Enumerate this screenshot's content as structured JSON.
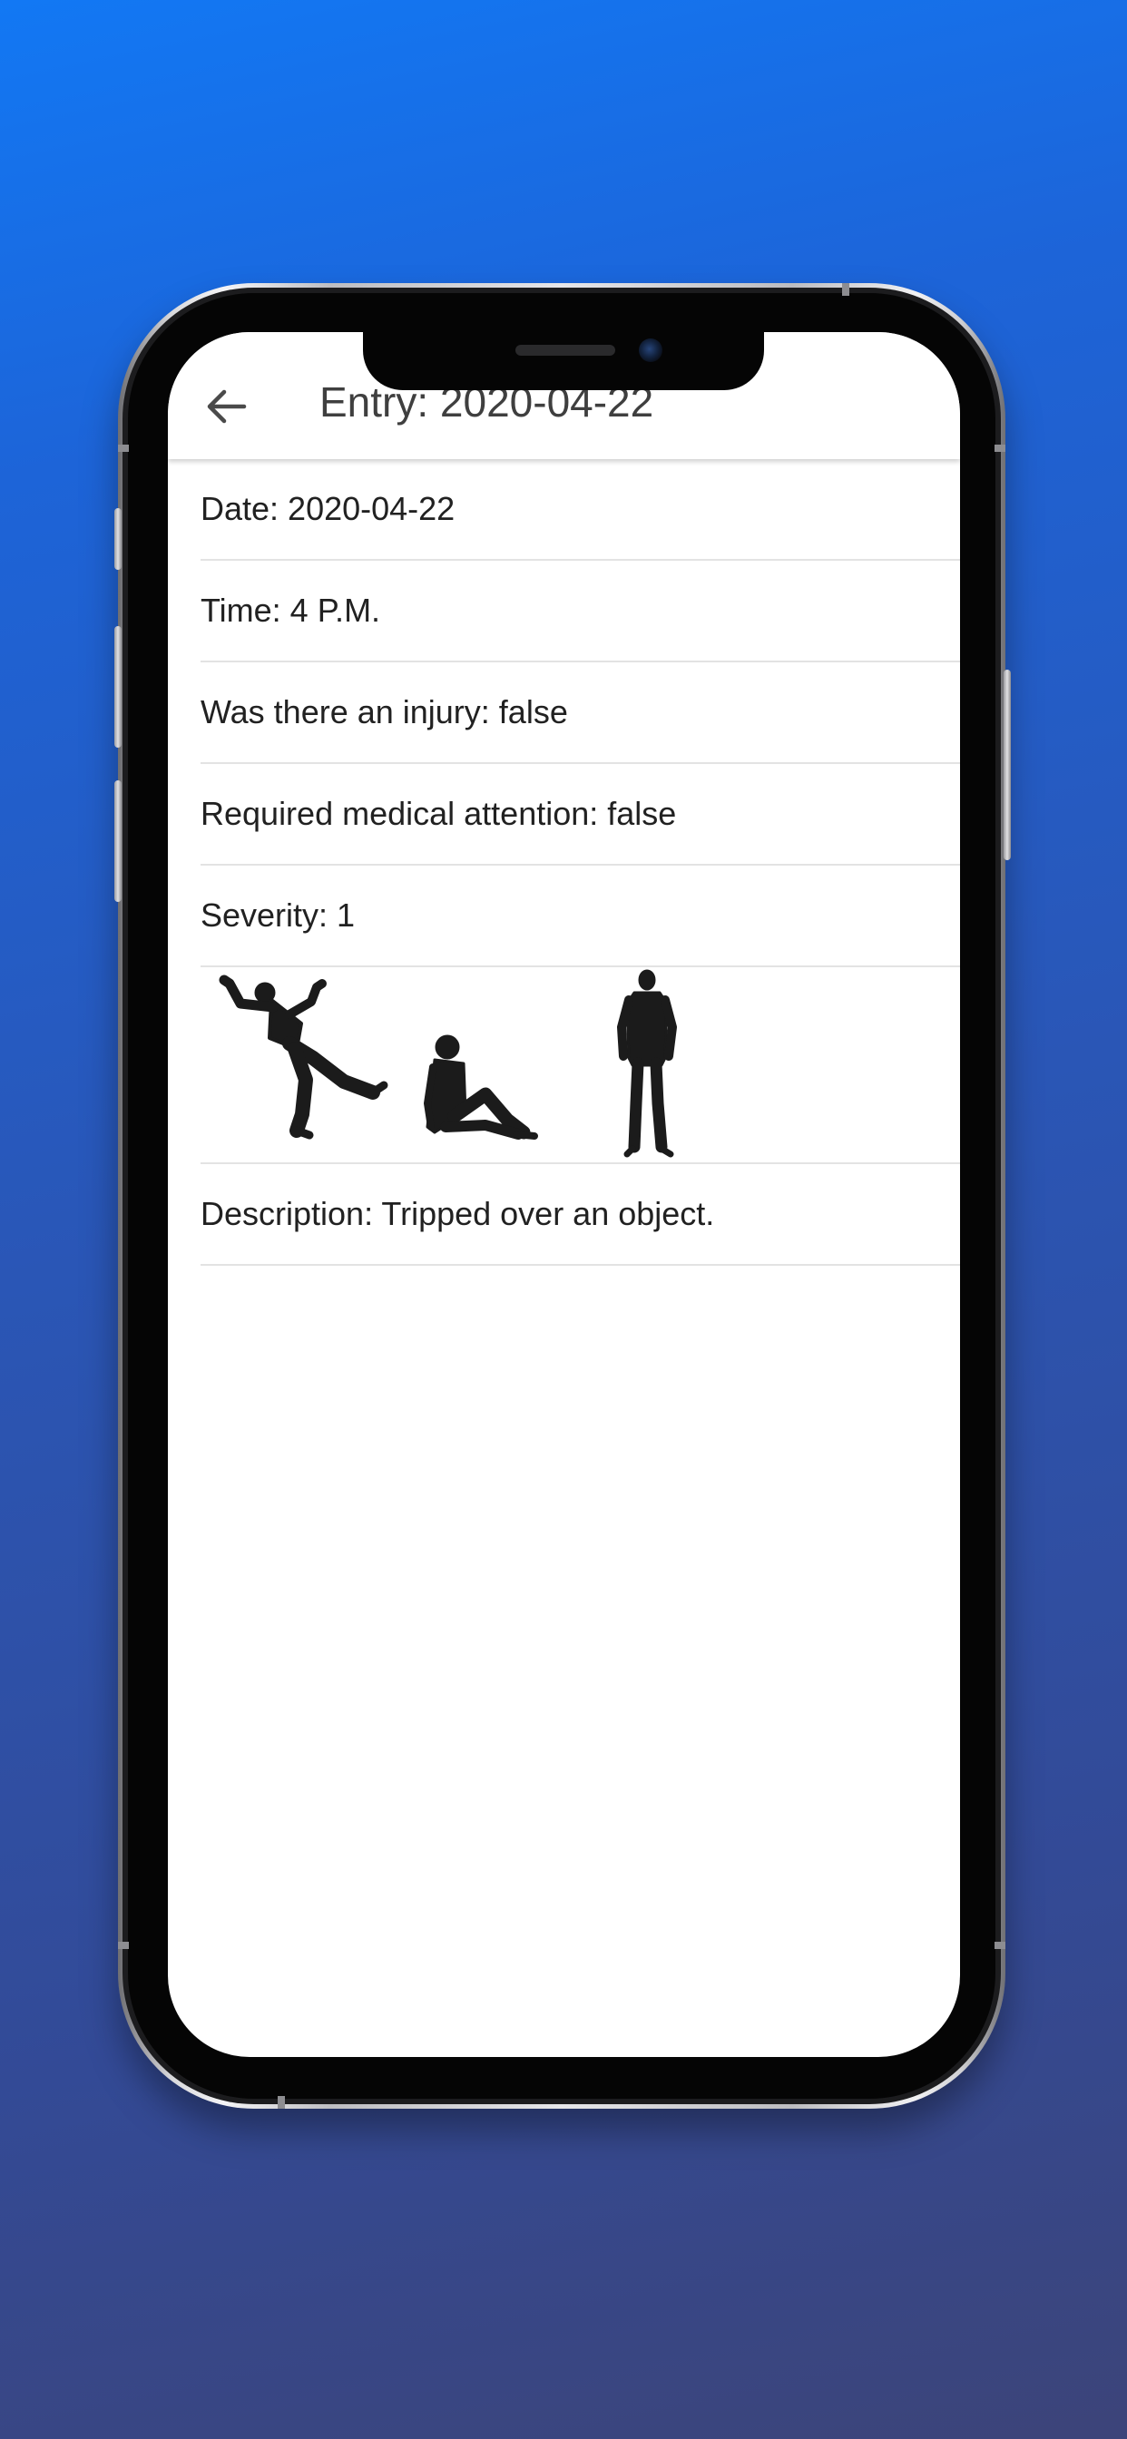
{
  "app_bar": {
    "back_icon": "arrow-left-icon",
    "title": "Entry: 2020-04-22"
  },
  "details": {
    "date": "Date: 2020-04-22",
    "time": "Time: 4 P.M.",
    "injury": "Was there an injury: false",
    "medical": "Required medical attention: false",
    "severity": "Severity: 1",
    "images": [
      "person-falling-icon",
      "person-sitting-icon",
      "person-standing-icon"
    ],
    "description": "Description: Tripped over an object."
  },
  "colors": {
    "background_top": "#1278f4",
    "background_bottom": "#3c4479",
    "screen": "#ffffff",
    "text": "#212121",
    "divider": "#e3e3e3"
  }
}
